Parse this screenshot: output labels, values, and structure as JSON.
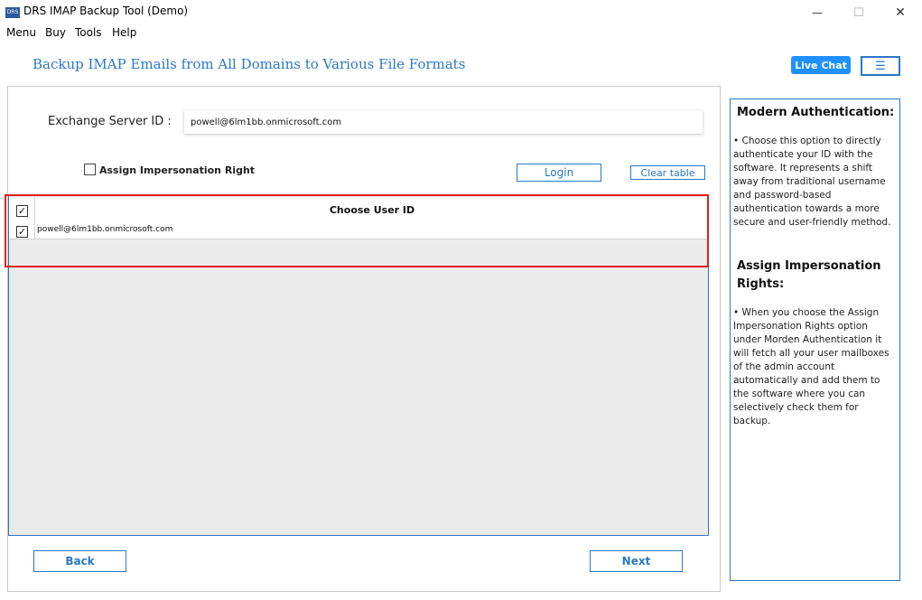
{
  "window": {
    "icon_text": "DRS",
    "title": "DRS IMAP Backup Tool (Demo)",
    "minimize": "—",
    "maximize": "☐",
    "close": "✕"
  },
  "menu": [
    "Menu",
    "Buy",
    "Tools",
    "Help"
  ],
  "header": {
    "title": "Backup IMAP Emails from All Domains to Various File Formats",
    "live_chat": "Live Chat",
    "hamburger": "☰"
  },
  "form": {
    "server_label": "Exchange Server ID :",
    "server_value": "powell@6lm1bb.onmicrosoft.com",
    "assign_label": "Assign Impersonation Right",
    "assign_checked": false,
    "login_label": "Login",
    "clear_label": "Clear table"
  },
  "table": {
    "header_title": "Choose User ID",
    "header_checked": true,
    "rows": [
      {
        "checked": true,
        "email": "powell@6lm1bb.onmicrosoft.com"
      }
    ]
  },
  "footer": {
    "back_label": "Back",
    "next_label": "Next"
  },
  "side_panel": {
    "heading1": "Modern Authentication:",
    "text1": "•  Choose this option to directly authenticate your ID with the software. It represents a shift away from traditional username and password-based authentication towards a more secure and user-friendly method.",
    "heading2": "Assign Impersonation Rights:",
    "text2": "•  When you choose the Assign Impersonation Rights option under Morden Authentication it will fetch all your user mailboxes of the admin account automatically and add them to the software where you can selectively check them for backup."
  },
  "colors": {
    "accent": "#2b78c4",
    "live_chat_bg": "#1e90ff",
    "highlight": "#e02020"
  }
}
